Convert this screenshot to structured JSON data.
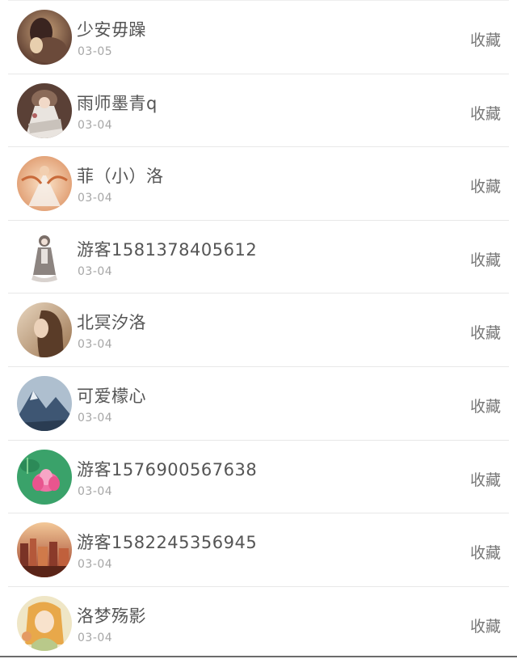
{
  "list": {
    "items": [
      {
        "name": "少安毋躁",
        "date": "03-05",
        "action": "收藏",
        "avatar": "avatar-brown-figure"
      },
      {
        "name": "雨师墨青q",
        "date": "03-04",
        "action": "收藏",
        "avatar": "avatar-white-dress"
      },
      {
        "name": "菲（小）洛",
        "date": "03-04",
        "action": "收藏",
        "avatar": "avatar-golden-angel"
      },
      {
        "name": "游客1581378405612",
        "date": "03-04",
        "action": "收藏",
        "avatar": "avatar-lolita-doll"
      },
      {
        "name": "北冥汐洛",
        "date": "03-04",
        "action": "收藏",
        "avatar": "avatar-girl-portrait"
      },
      {
        "name": "可爱檬心",
        "date": "03-04",
        "action": "收藏",
        "avatar": "avatar-blue-mountain"
      },
      {
        "name": "游客1576900567638",
        "date": "03-04",
        "action": "收藏",
        "avatar": "avatar-lotus-flower"
      },
      {
        "name": "游客1582245356945",
        "date": "03-04",
        "action": "收藏",
        "avatar": "avatar-city-sunset"
      },
      {
        "name": "洛梦殇影",
        "date": "03-04",
        "action": "收藏",
        "avatar": "avatar-anime-girl"
      }
    ]
  }
}
